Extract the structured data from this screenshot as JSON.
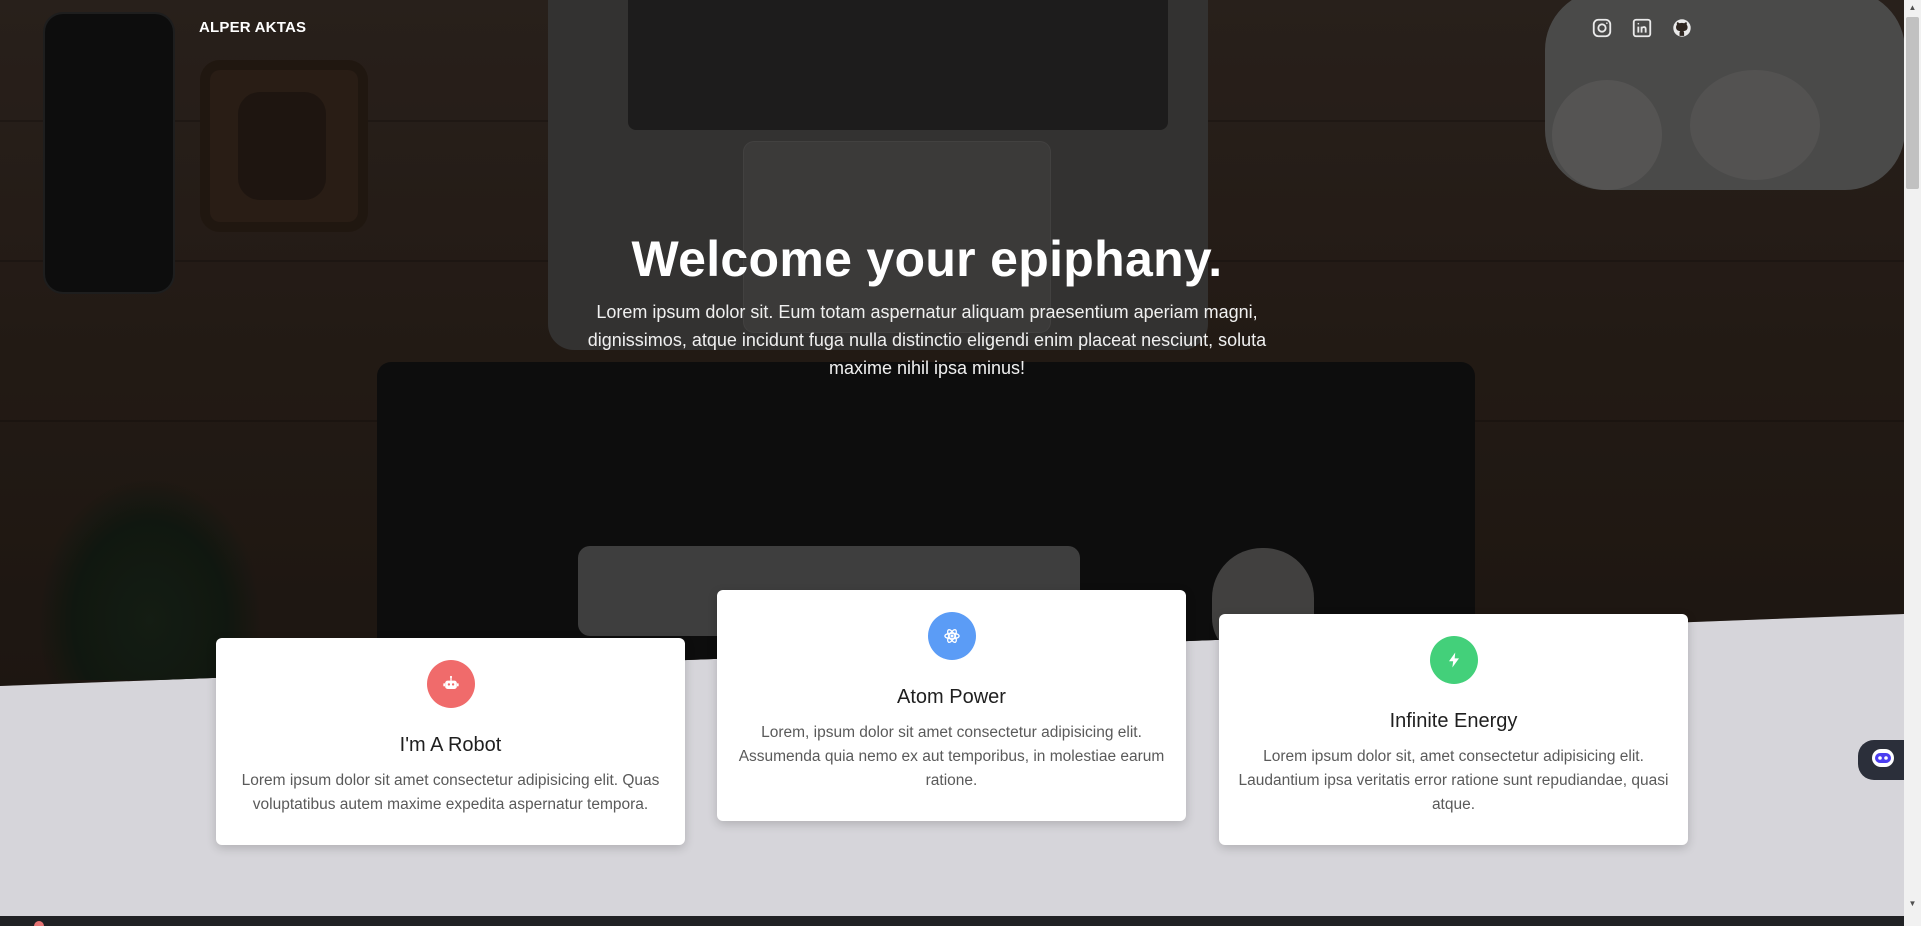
{
  "header": {
    "brand": "ALPER AKTAS",
    "social": [
      {
        "icon": "instagram-icon"
      },
      {
        "icon": "linkedin-icon"
      },
      {
        "icon": "github-icon"
      }
    ]
  },
  "hero": {
    "title": "Welcome your epiphany.",
    "subtitle": "Lorem ipsum dolor sit. Eum totam aspernatur aliquam praesentium aperiam magni, dignissimos, atque incidunt fuga nulla distinctio eligendi enim placeat nesciunt, soluta maxime nihil ipsa minus!"
  },
  "cards": [
    {
      "icon": "robot-icon",
      "color": "#f06b6b",
      "title": "I'm A Robot",
      "text": "Lorem ipsum dolor sit amet consectetur adipisicing elit. Quas voluptatibus autem maxime expedita aspernatur tempora."
    },
    {
      "icon": "atom-icon",
      "color": "#5b9cf6",
      "title": "Atom Power",
      "text": "Lorem, ipsum dolor sit amet consectetur adipisicing elit. Assumenda quia nemo ex aut temporibus, in molestiae earum ratione."
    },
    {
      "icon": "lightning-icon",
      "color": "#43d07a",
      "title": "Infinite Energy",
      "text": "Lorem ipsum dolor sit, amet consectetur adipisicing elit. Laudantium ipsa veritatis error ratione sunt repudiandae, quasi atque."
    }
  ],
  "colors": {
    "page_background": "#d6d5da",
    "card_background": "#ffffff"
  }
}
